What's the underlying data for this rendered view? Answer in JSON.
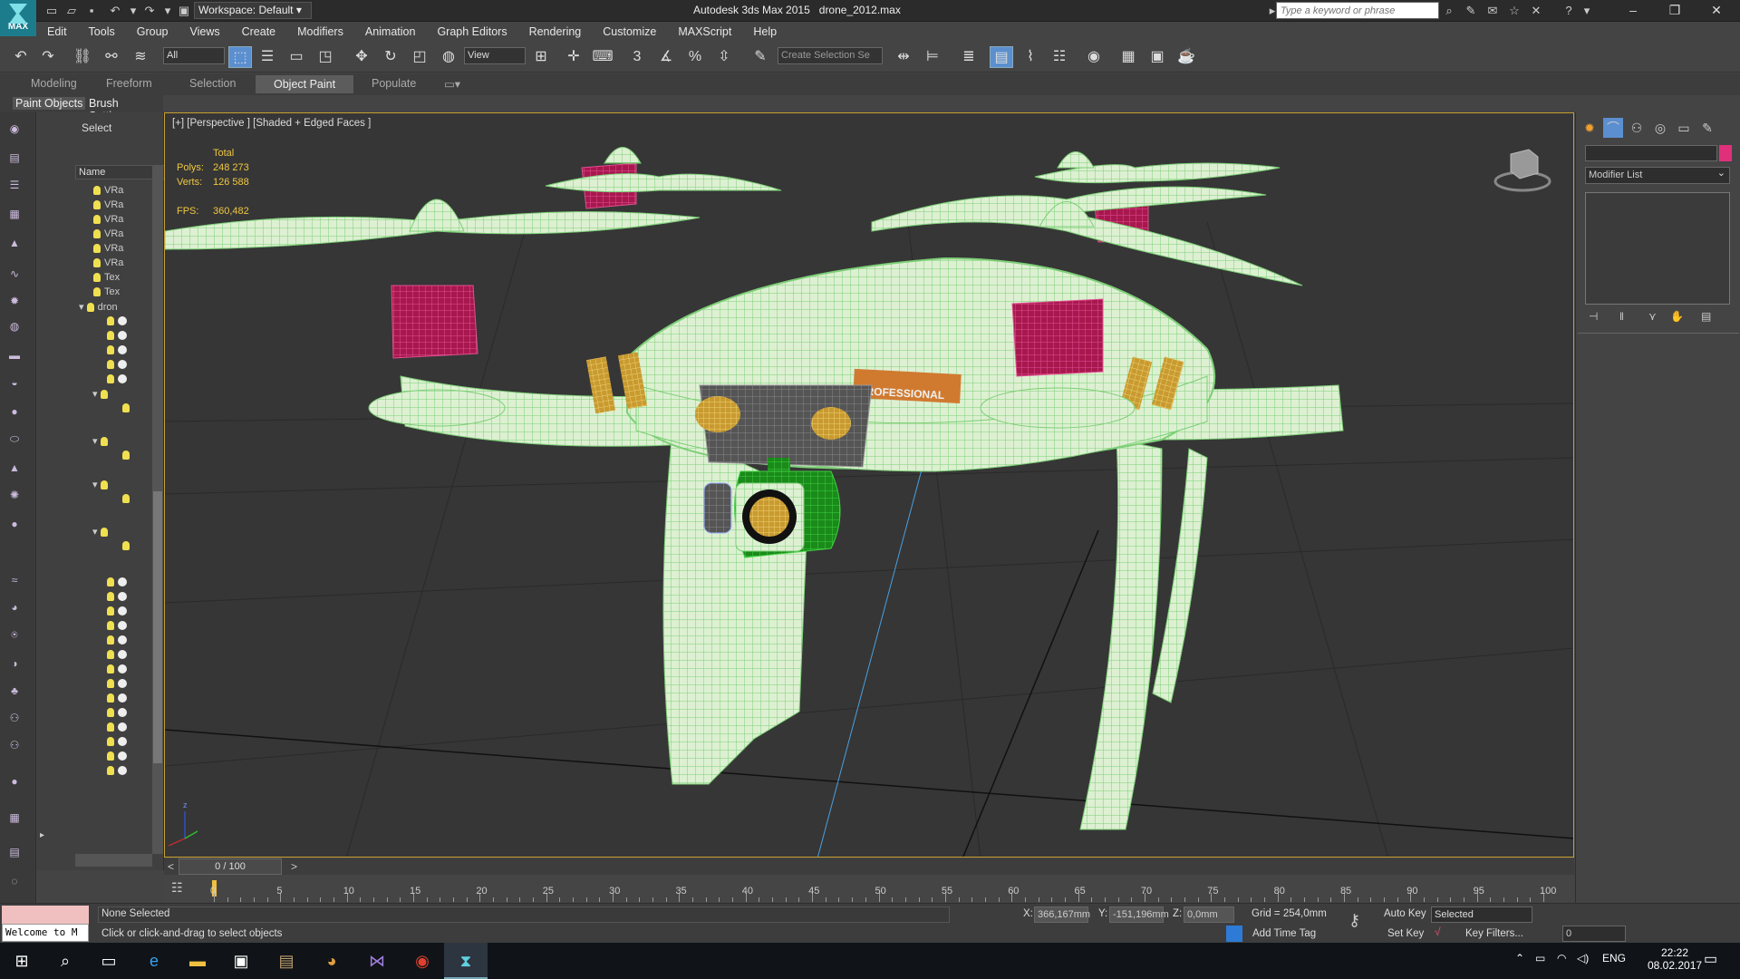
{
  "titlebar": {
    "app_icon_label": "MAX",
    "workspace": "Workspace: Default",
    "app_title": "Autodesk 3ds Max  2015",
    "file_name": "drone_2012.max",
    "search_placeholder": "Type a keyword or phrase"
  },
  "menu": [
    "Edit",
    "Tools",
    "Group",
    "Views",
    "Create",
    "Modifiers",
    "Animation",
    "Graph Editors",
    "Rendering",
    "Customize",
    "MAXScript",
    "Help"
  ],
  "toolbar": {
    "selection_filter": "All",
    "ref_coord": "View",
    "named_selection_placeholder": "Create Selection Se",
    "snap_3": "3",
    "snap_percent": "%"
  },
  "ribbon": {
    "tabs": [
      "Modeling",
      "Freeform",
      "Selection",
      "Object Paint",
      "Populate"
    ],
    "active_tab": "Object Paint",
    "subtabs": [
      "Paint Objects",
      "Brush Settings"
    ]
  },
  "scene_explorer": {
    "select_label": "Select",
    "name_header": "Name",
    "items": [
      "VRa",
      "VRa",
      "VRa",
      "VRa",
      "VRa",
      "VRa",
      "Tex",
      "Tex",
      "dron"
    ]
  },
  "viewport": {
    "label": "[+] [Perspective ] [Shaded + Edged Faces ]",
    "stats_total_label": "Total",
    "polys_label": "Polys:",
    "polys_value": "248 273",
    "verts_label": "Verts:",
    "verts_value": "126 588",
    "fps_label": "FPS:",
    "fps_value": "360,482",
    "decal_line1": "",
    "decal_line2": "PROFESSIONAL",
    "axis_z": "z"
  },
  "command_panel": {
    "modifier_list": "Modifier List"
  },
  "timeline": {
    "frame_counter": "0 / 100",
    "frame_current": 0,
    "frame_end": 100,
    "labels": [
      "0",
      "5",
      "10",
      "15",
      "20",
      "25",
      "30",
      "35",
      "40",
      "45",
      "50",
      "55",
      "60",
      "65",
      "70",
      "75",
      "80",
      "85",
      "90",
      "95",
      "100"
    ]
  },
  "status": {
    "welcome_text": "Welcome to M",
    "selection_status": "None Selected",
    "prompt": "Click or click-and-drag to select objects",
    "x_label": "X:",
    "x_value": "366,167mm",
    "y_label": "Y:",
    "y_value": "-151,196mm",
    "z_label": "Z:",
    "z_value": "0,0mm",
    "grid": "Grid = 254,0mm",
    "add_time_tag": "Add Time Tag",
    "auto_key": "Auto Key",
    "auto_key_mode": "Selected",
    "set_key": "Set Key",
    "key_filters": "Key Filters...",
    "frame_spinner": "0"
  },
  "taskbar": {
    "language": "ENG",
    "time": "22:22",
    "date": "08.02.2017"
  },
  "colors": {
    "viewport_border": "#c8a030",
    "stats_text": "#f0c840",
    "wire_green": "#8fe08a",
    "motor_magenta": "#b02060",
    "active_tab": "#5c5c5c"
  }
}
